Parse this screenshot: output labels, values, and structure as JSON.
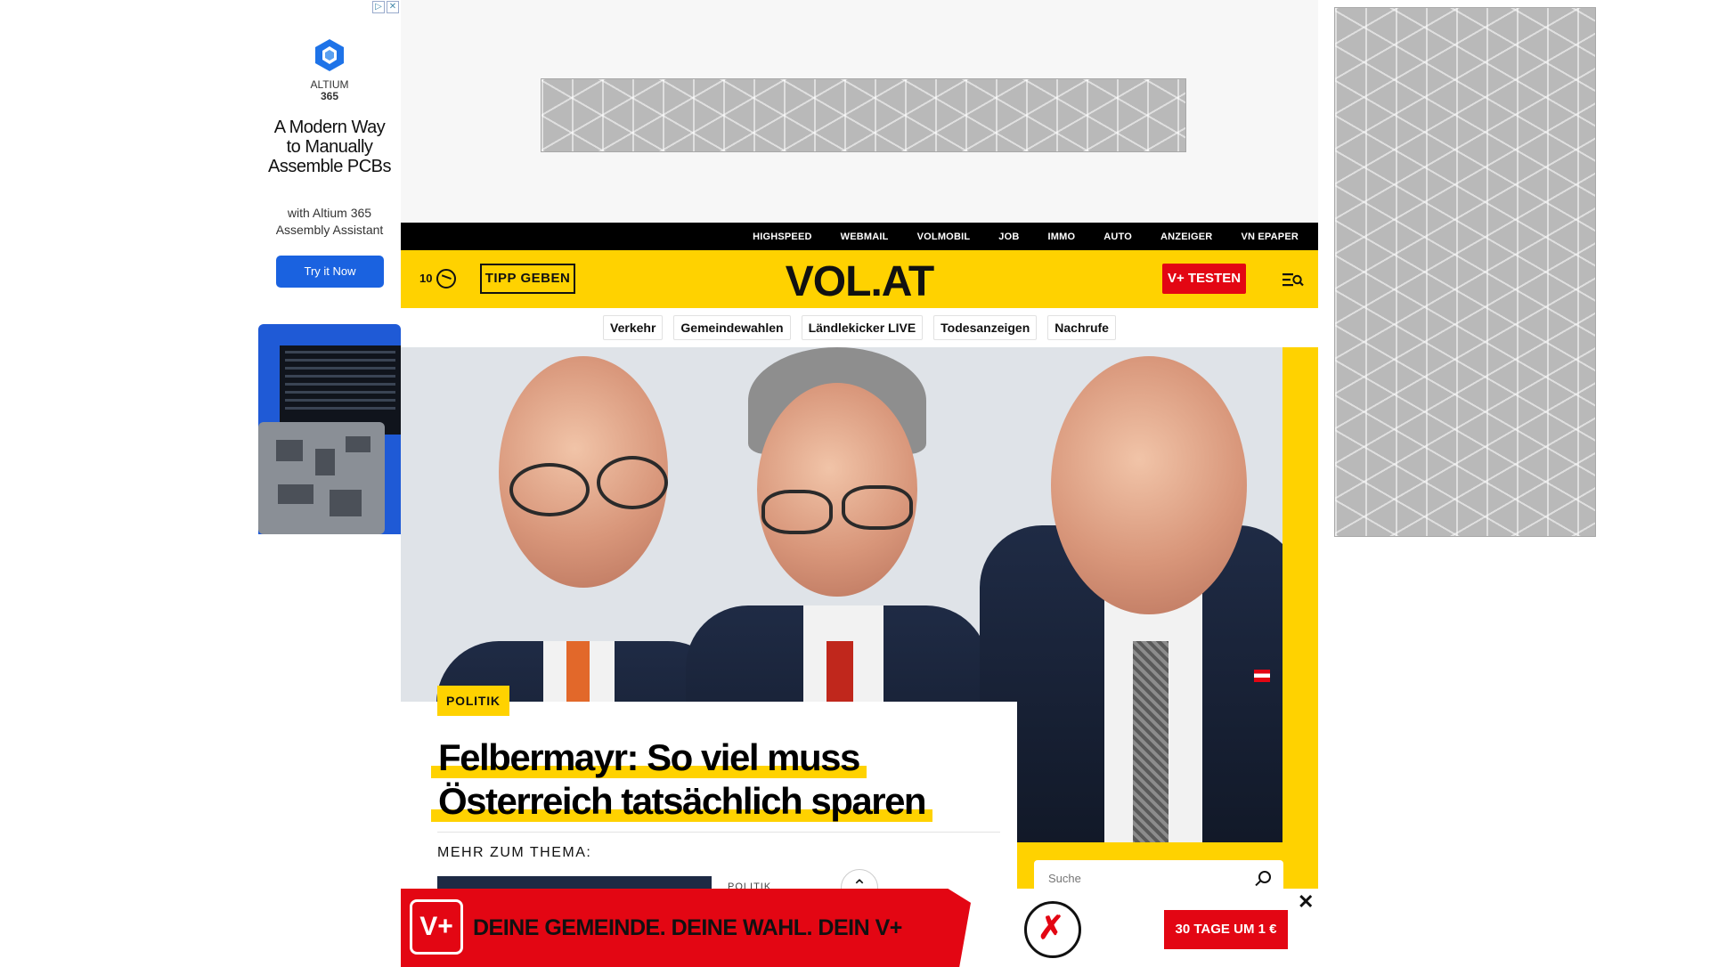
{
  "left_ad": {
    "brand_line1": "ALTIUM",
    "brand_line2": "365",
    "headline": "A Modern Way to Manually Assemble PCBs",
    "subtext": "with Altium 365 Assembly Assistant",
    "cta": "Try it Now",
    "adchoices": [
      "▷",
      "✕"
    ]
  },
  "service_bar": {
    "links": [
      "HIGHSPEED",
      "WEBMAIL",
      "VOLMOBIL",
      "JOB",
      "IMMO",
      "AUTO",
      "ANZEIGER",
      "VN EPAPER"
    ]
  },
  "header": {
    "count": "10",
    "tipp_label": "TIPP GEBEN",
    "logo": "VOL.AT",
    "vplus_label": "V+ TESTEN"
  },
  "chips": [
    "Verkehr",
    "Gemeindewahlen",
    "Ländlekicker LIVE",
    "Todesanzeigen",
    "Nachrufe"
  ],
  "article": {
    "category": "POLITIK",
    "title_line1": "Felbermayr: So viel muss",
    "title_line2": "Österreich tatsächlich sparen",
    "more_label": "MEHR ZUM THEMA:",
    "related_category": "POLITIK"
  },
  "sidebar": {
    "search_placeholder": "Suche"
  },
  "sticky_banner": {
    "badge": "V+",
    "slogan": "DEINE GEMEINDE. DEINE WAHL. DEIN V+",
    "cta": "30 TAGE UM 1 €",
    "close": "✕"
  },
  "colors": {
    "brand_yellow": "#ffd200",
    "brand_red": "#e30613",
    "black": "#000000"
  }
}
